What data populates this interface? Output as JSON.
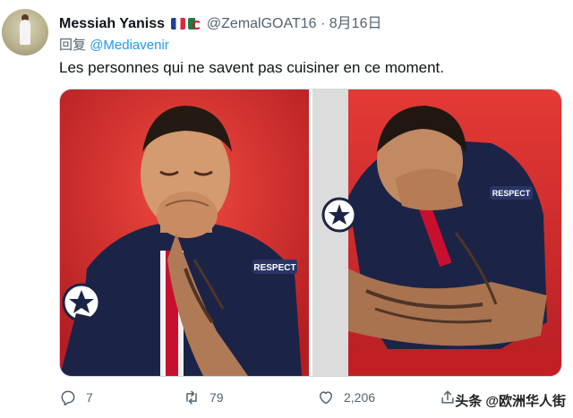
{
  "author": {
    "name": "Messiah Yaniss",
    "handle": "@ZemalGOAT16",
    "separator": "·",
    "date": "8月16日",
    "flags": [
      "france-flag",
      "algeria-flag"
    ]
  },
  "reply": {
    "prefix": "回复",
    "mention": "@Mediavenir"
  },
  "tweet_text": "Les personnes qui ne savent pas cuisiner en ce moment.",
  "media": {
    "photos": [
      {
        "label": "crying-player-photo-left",
        "patch_text": "RESPECT"
      },
      {
        "label": "crying-player-photo-right",
        "patch_text": "RESPECT"
      }
    ]
  },
  "actions": {
    "reply_count": "7",
    "retweet_count": "79",
    "like_count": "2,206"
  },
  "watermark": "头条 @欧洲华人街",
  "colors": {
    "accent": "#1d9bf0",
    "muted": "#536471",
    "text": "#0f1419",
    "seat_red": "#d7262b",
    "jersey_navy": "#1b2447"
  }
}
